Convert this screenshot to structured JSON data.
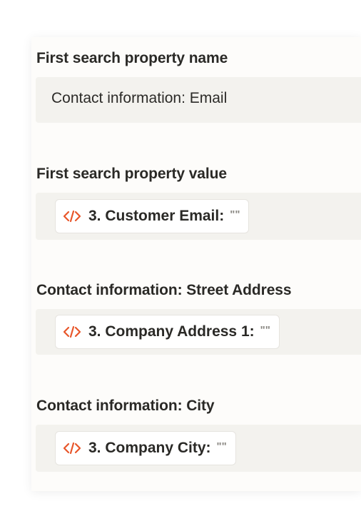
{
  "fields": [
    {
      "label": "First search property name",
      "value": "Contact information: Email"
    },
    {
      "label": "First search property value",
      "pill_text": "3. Customer Email:",
      "pill_suffix": "\"\""
    },
    {
      "label": "Contact information: Street Address",
      "pill_text": "3. Company Address 1:",
      "pill_suffix": "\"\""
    },
    {
      "label": "Contact information: City",
      "pill_text": "3. Company City:",
      "pill_suffix": "\"\""
    }
  ],
  "icons": {
    "pill_icon": "code-icon"
  },
  "colors": {
    "icon_accent": "#e8562a",
    "field_bg": "#f3f2ee",
    "panel_bg": "#fdfcfa"
  }
}
